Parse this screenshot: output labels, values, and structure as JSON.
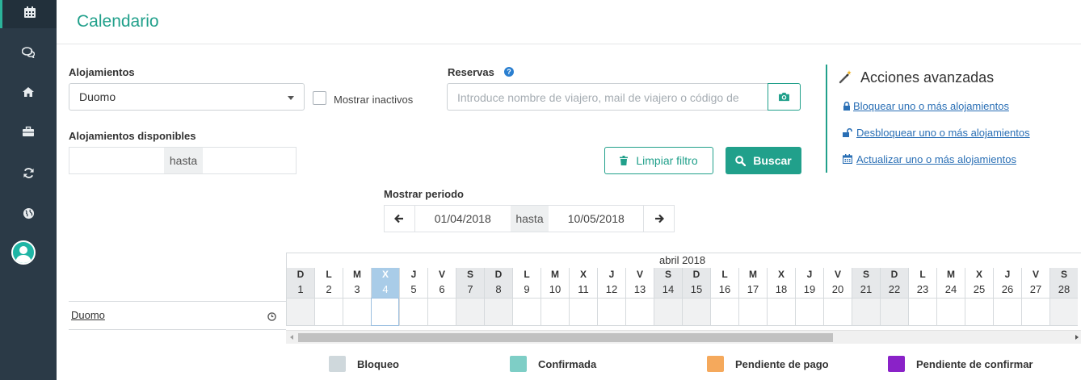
{
  "page": {
    "title": "Calendario"
  },
  "sidebar": {
    "items": [
      {
        "name": "calendar",
        "icon": "calendar-icon",
        "active": true
      },
      {
        "name": "messages",
        "icon": "chat-icon"
      },
      {
        "name": "properties",
        "icon": "home-icon"
      },
      {
        "name": "briefcase",
        "icon": "briefcase-icon"
      },
      {
        "name": "sync",
        "icon": "refresh-icon"
      },
      {
        "name": "web",
        "icon": "globe-icon"
      }
    ],
    "avatar_icon": "user-avatar-icon"
  },
  "filters": {
    "alojamientos_label": "Alojamientos",
    "alojamientos_value": "Duomo",
    "mostrar_inactivos_label": "Mostrar inactivos",
    "reservas_label": "Reservas",
    "reservas_placeholder": "Introduce nombre de viajero, mail de viajero o código de",
    "disponibles_label": "Alojamientos disponibles",
    "disponibles_sep": "hasta",
    "clear_button": "Limpiar filtro",
    "search_button": "Buscar"
  },
  "advanced": {
    "title": "Acciones avanzadas",
    "links": [
      {
        "label": "Bloquear uno o más alojamientos",
        "icon": "lock-icon"
      },
      {
        "label": "Desbloquear uno o más alojamientos",
        "icon": "unlock-icon"
      },
      {
        "label": "Actualizar uno o más alojamientos",
        "icon": "calendar-icon"
      }
    ]
  },
  "period": {
    "label": "Mostrar periodo",
    "from": "01/04/2018",
    "sep": "hasta",
    "to": "10/05/2018"
  },
  "calendar": {
    "month": "abril 2018",
    "days": [
      {
        "wd": "D",
        "n": "1",
        "we": true
      },
      {
        "wd": "L",
        "n": "2"
      },
      {
        "wd": "M",
        "n": "3"
      },
      {
        "wd": "X",
        "n": "4",
        "today": true
      },
      {
        "wd": "J",
        "n": "5"
      },
      {
        "wd": "V",
        "n": "6"
      },
      {
        "wd": "S",
        "n": "7",
        "we": true
      },
      {
        "wd": "D",
        "n": "8",
        "we": true
      },
      {
        "wd": "L",
        "n": "9"
      },
      {
        "wd": "M",
        "n": "10"
      },
      {
        "wd": "X",
        "n": "11"
      },
      {
        "wd": "J",
        "n": "12"
      },
      {
        "wd": "V",
        "n": "13"
      },
      {
        "wd": "S",
        "n": "14",
        "we": true
      },
      {
        "wd": "D",
        "n": "15",
        "we": true
      },
      {
        "wd": "L",
        "n": "16"
      },
      {
        "wd": "M",
        "n": "17"
      },
      {
        "wd": "X",
        "n": "18"
      },
      {
        "wd": "J",
        "n": "19"
      },
      {
        "wd": "V",
        "n": "20"
      },
      {
        "wd": "S",
        "n": "21",
        "we": true
      },
      {
        "wd": "D",
        "n": "22",
        "we": true
      },
      {
        "wd": "L",
        "n": "23"
      },
      {
        "wd": "M",
        "n": "24"
      },
      {
        "wd": "X",
        "n": "25"
      },
      {
        "wd": "J",
        "n": "26"
      },
      {
        "wd": "V",
        "n": "27"
      },
      {
        "wd": "S",
        "n": "28",
        "we": true
      }
    ],
    "rows": [
      {
        "name": "Duomo",
        "icon": "clock-icon"
      }
    ]
  },
  "legend": [
    {
      "label": "Bloqueo",
      "color": "#cfd8dc"
    },
    {
      "label": "Confirmada",
      "color": "#7ecec6"
    },
    {
      "label": "Pendiente de pago",
      "color": "#f5a95c"
    },
    {
      "label": "Pendiente de confirmar",
      "color": "#8a22c8"
    }
  ],
  "colors": {
    "accent": "#21a08b",
    "sidebar": "#2b3a47",
    "link": "#2a6fb5"
  }
}
